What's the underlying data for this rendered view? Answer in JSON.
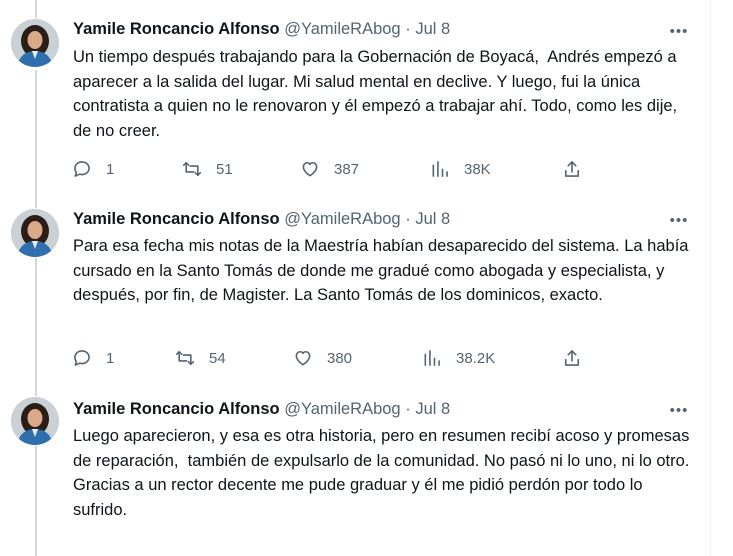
{
  "tweets": [
    {
      "author": "Yamile Roncancio Alfonso",
      "handle": "@YamileRAbog",
      "separator": "·",
      "date": "Jul 8",
      "more": "•••",
      "text": "Un tiempo después trabajando para la Gobernación de Boyacá,  Andrés empezó a aparecer a la salida del lugar. Mi salud mental en declive. Y luego, fui la única contratista a quien no le renovaron y él empezó a trabajar ahí. Todo, como les dije, de no creer.",
      "replies": "1",
      "retweets": "51",
      "likes": "387",
      "views": "38K"
    },
    {
      "author": "Yamile Roncancio Alfonso",
      "handle": "@YamileRAbog",
      "separator": "·",
      "date": "Jul 8",
      "more": "•••",
      "text": "Para esa fecha mis notas de la Maestría habían desaparecido del sistema. La había cursado en la Santo Tomás de donde me gradué como abogada y especialista, y después, por fin, de Magister. La Santo Tomás de los dominicos, exacto.",
      "replies": "1",
      "retweets": "54",
      "likes": "380",
      "views": "38.2K"
    },
    {
      "author": "Yamile Roncancio Alfonso",
      "handle": "@YamileRAbog",
      "separator": "·",
      "date": "Jul 8",
      "more": "•••",
      "text": "Luego aparecieron, y esa es otra historia, pero en resumen recibí acoso y promesas de reparación,  también de expulsarlo de la comunidad. No pasó ni lo uno, ni lo otro.\nGracias a un rector decente me pude graduar y él me pidió perdón por todo lo sufrido."
    }
  ],
  "colors": {
    "text": "#0f1419",
    "secondary": "#536471",
    "thread_line": "#cfd9de",
    "avatar_jacket": "#2f6fae"
  },
  "icons": [
    "reply-icon",
    "retweet-icon",
    "like-icon",
    "views-icon",
    "share-icon",
    "more-icon"
  ]
}
